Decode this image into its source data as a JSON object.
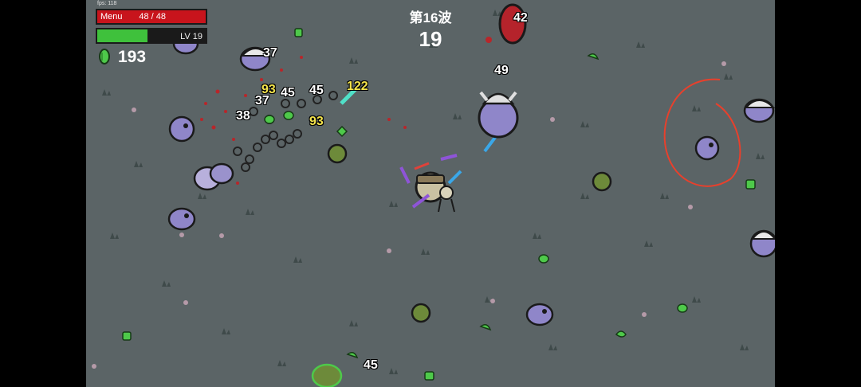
{
  "hud": {
    "fps": "fps: 118",
    "menu_label": "Menu",
    "hp_text": "48 / 48",
    "hp_fraction": 1.0,
    "level_text": "LV 19",
    "xp_fraction": 0.46,
    "materials": "193"
  },
  "wave": {
    "title": "第16波",
    "timer": "19"
  },
  "damage_numbers": [
    "37",
    "45",
    "45",
    "122",
    "37",
    "93",
    "93",
    "38",
    "49",
    "42",
    "45"
  ],
  "colors": {
    "ground": "#5b6466",
    "hp": "#c8141c",
    "xp": "#3fc13c",
    "material": "#4ec94a",
    "crit": "#f4e44c",
    "enemy_purple": "#8f86c9",
    "circle_annotation": "#e8402c"
  }
}
